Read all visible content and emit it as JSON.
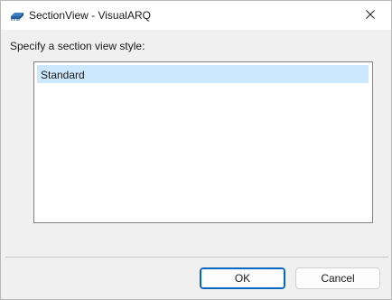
{
  "window": {
    "title": "SectionView - VisualARQ",
    "app_icon": "visualarq-icon",
    "close_icon": "close-icon"
  },
  "prompt": {
    "label": "Specify a section view style:"
  },
  "style_list": {
    "items": [
      {
        "label": "Standard",
        "selected": true
      }
    ]
  },
  "buttons": {
    "ok_label": "OK",
    "cancel_label": "Cancel"
  },
  "colors": {
    "selection": "#cce8ff",
    "default_button_border": "#0067c0"
  }
}
